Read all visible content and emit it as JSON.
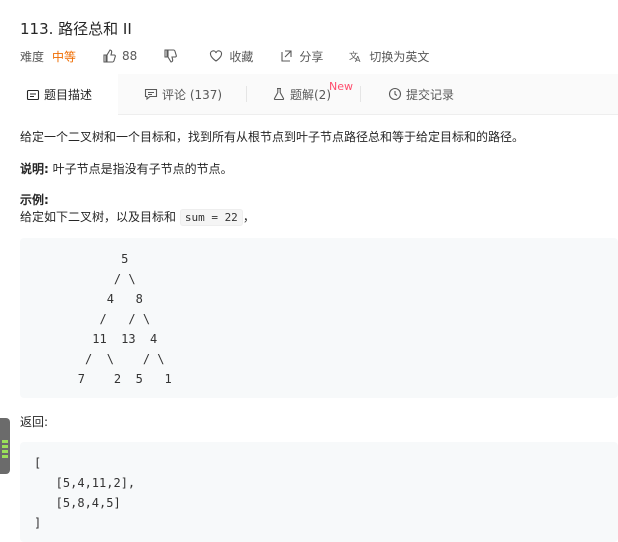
{
  "header": {
    "title": "113. 路径总和 II",
    "difficulty_label": "难度",
    "difficulty": "中等",
    "likes": "88",
    "favorite": "收藏",
    "share": "分享",
    "translate": "切换为英文"
  },
  "tabs": [
    {
      "label": "题目描述"
    },
    {
      "label": "评论 (137)"
    },
    {
      "label": "题解(2)",
      "badge": "New"
    },
    {
      "label": "提交记录"
    }
  ],
  "problem": {
    "description": "给定一个二叉树和一个目标和，找到所有从根节点到叶子节点路径总和等于给定目标和的路径。",
    "note_label": "说明:",
    "note_text": " 叶子节点是指没有子节点的节点。",
    "example_label": "示例:",
    "example_intro": "给定如下二叉树，以及目标和 ",
    "example_code": "sum = 22",
    "example_end": "，",
    "tree_lines": [
      "              5",
      "             / \\",
      "            4   8",
      "           /   / \\",
      "          11  13  4",
      "         /  \\    / \\",
      "        7    2  5   1"
    ],
    "return_label": "返回:",
    "result_lines": [
      "[",
      "   [5,4,11,2],",
      "   [5,8,4,5]",
      "]"
    ]
  },
  "colors": {
    "accent": "#ef6c00",
    "badge": "#ff4d6d",
    "code_bg": "#f7f9fa"
  }
}
